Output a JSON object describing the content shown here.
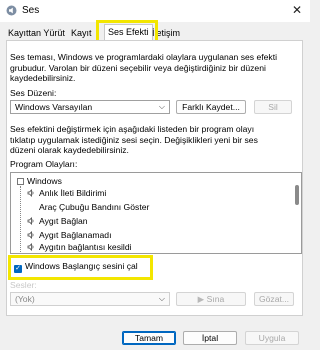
{
  "window": {
    "title": "Ses",
    "close_glyph": "✕"
  },
  "tabs": [
    {
      "label": "Kayıttan Yürüt"
    },
    {
      "label": "Kayıt"
    },
    {
      "label": "Ses Efekti"
    },
    {
      "label": "İletişim"
    }
  ],
  "intro_lines": [
    "Ses teması, Windows ve programlardaki olaylara uygulanan ses efekti",
    "grubudur. Varolan bir düzeni seçebilir veya değiştirdiğiniz bir düzeni",
    "kaydedebilirsiniz."
  ],
  "scheme": {
    "label": "Ses Düzeni:",
    "selected": "Windows Varsayılan",
    "save_as_label": "Farklı Kaydet...",
    "delete_label": "Sil"
  },
  "instruction_lines": [
    "Ses efektini değiştirmek için aşağıdaki listeden bir program olayı",
    "tıklatıp uygulamak istediğiniz sesi seçin. Değişiklikleri yeni bir ses",
    "düzeni olarak kaydedebilirsiniz."
  ],
  "events": {
    "label": "Program Olayları:",
    "group": "Windows",
    "items": [
      {
        "label": "Anlık İleti Bildirimi",
        "has_sound": true
      },
      {
        "label": "Araç Çubuğu Bandını Göster",
        "has_sound": false
      },
      {
        "label": "Aygıt Bağlan",
        "has_sound": true
      },
      {
        "label": "Aygıt Bağlanamadı",
        "has_sound": true
      },
      {
        "label": "Aygıtın bağlantısı kesildi",
        "has_sound": true
      }
    ]
  },
  "startup_checkbox": {
    "label": "Windows Başlangıç sesini çal",
    "checked": true,
    "check_glyph": "✓"
  },
  "sounds": {
    "label": "Sesler:",
    "selected": "(Yok)",
    "test_label": "Sına",
    "browse_label": "Gözat..."
  },
  "footer": {
    "ok_label": "Tamam",
    "cancel_label": "İptal",
    "apply_label": "Uygula"
  },
  "colors": {
    "accent": "#0067c0",
    "highlight": "#f3e600"
  }
}
